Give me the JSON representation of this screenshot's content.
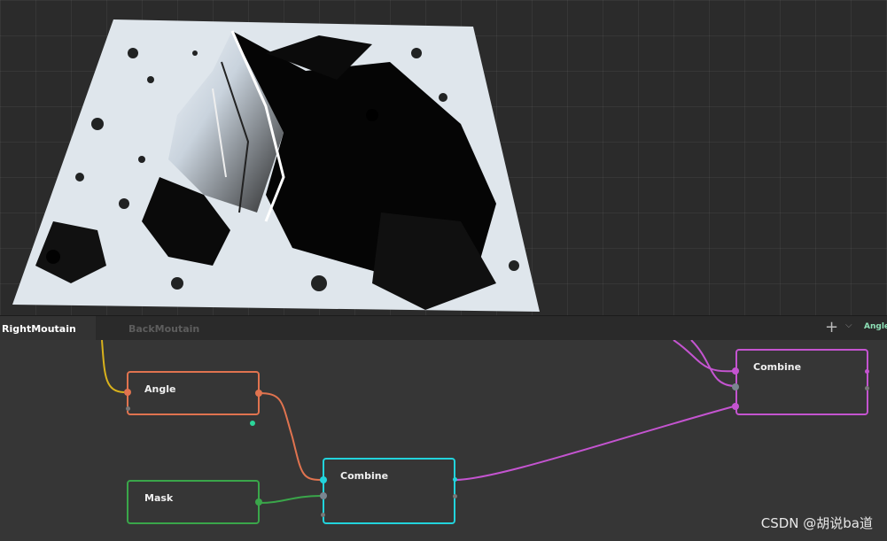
{
  "tabs": [
    {
      "label": "RightMoutain",
      "active": true
    },
    {
      "label": "BackMoutain",
      "active": false
    }
  ],
  "tabbar": {
    "add_symbol": "+",
    "chevron_symbol": "⌵",
    "current_node": "Angle"
  },
  "nodes": {
    "angle": {
      "title": "Angle",
      "color": "#e0734f"
    },
    "mask": {
      "title": "Mask",
      "color": "#3aa64a"
    },
    "combine_center": {
      "title": "Combine",
      "color": "#22d3dc"
    },
    "combine_right": {
      "title": "Combine",
      "color": "#c454d0"
    }
  },
  "watermark": "CSDN @胡说ba道"
}
